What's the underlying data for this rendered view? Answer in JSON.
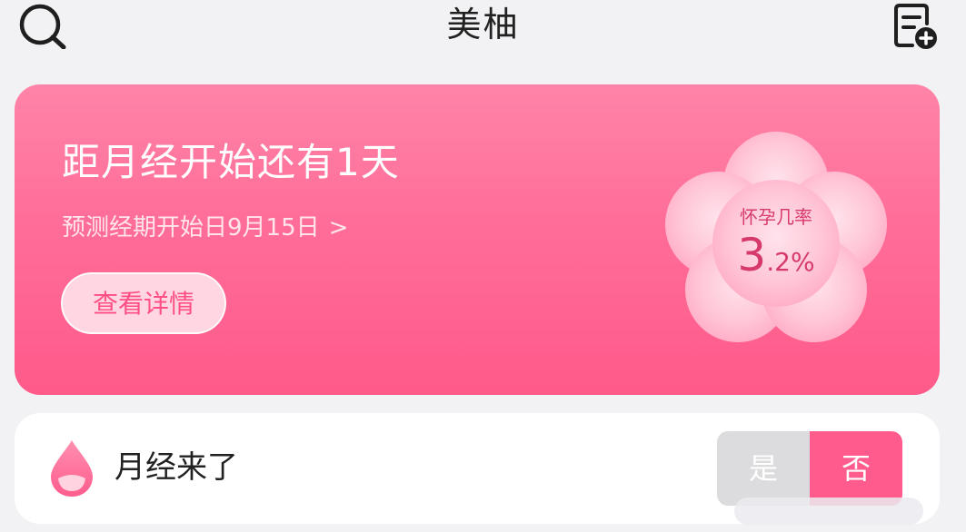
{
  "header": {
    "title": "美柚",
    "search_icon": "search-icon",
    "record_icon": "add-record-icon"
  },
  "hero": {
    "title": "距月经开始还有1天",
    "subtitle": "预测经期开始日9月15日",
    "subtitle_chevron": ">",
    "detail_button": "查看详情",
    "pregnancy_label": "怀孕几率",
    "pregnancy_value": "3",
    "pregnancy_decimal": ".2%",
    "colors": {
      "gradient_top": "#ff84a8",
      "gradient_bottom": "#ff5a8a",
      "accent": "#ff4f84"
    }
  },
  "period": {
    "label": "月经来了",
    "yes_label": "是",
    "no_label": "否",
    "selected": "否",
    "colors": {
      "yes_bg": "#dcdcde",
      "no_bg": "#ff5c8d"
    }
  }
}
